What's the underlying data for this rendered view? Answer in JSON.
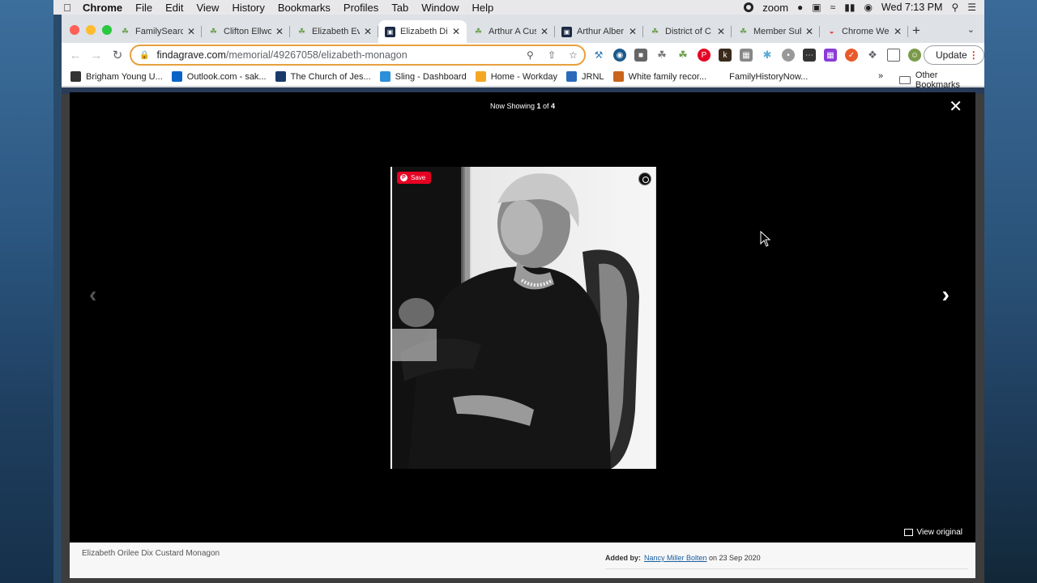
{
  "menubar": {
    "app": "Chrome",
    "items": [
      "File",
      "Edit",
      "View",
      "History",
      "Bookmarks",
      "Profiles",
      "Tab",
      "Window",
      "Help"
    ],
    "zoom": "zoom",
    "clock": "Wed 7:13 PM"
  },
  "tabs": [
    {
      "label": "FamilySearch",
      "icon": "tree-icon"
    },
    {
      "label": "Clifton Ellwo",
      "icon": "tree-icon"
    },
    {
      "label": "Elizabeth Ev",
      "icon": "tree-icon"
    },
    {
      "label": "Elizabeth Di",
      "icon": "findagrave-icon",
      "active": true
    },
    {
      "label": "Arthur A Cus",
      "icon": "tree-icon"
    },
    {
      "label": "Arthur Alber",
      "icon": "findagrave-icon"
    },
    {
      "label": "District of C",
      "icon": "tree-icon"
    },
    {
      "label": "Member Sub",
      "icon": "tree-icon"
    },
    {
      "label": "Chrome Web",
      "icon": "chrome-web-store-icon"
    }
  ],
  "address": {
    "host": "findagrave.com",
    "path": "/memorial/49267058/elizabeth-monagon"
  },
  "update_label": "Update",
  "bookmarks": [
    {
      "label": "Brigham Young U...",
      "color": "#333333"
    },
    {
      "label": "Outlook.com - sak...",
      "color": "#0a64c8"
    },
    {
      "label": "The Church of Jes...",
      "color": "#1a3a6a"
    },
    {
      "label": "Sling - Dashboard",
      "color": "#2d8fd8"
    },
    {
      "label": "Home - Workday",
      "color": "#f5a623"
    },
    {
      "label": "JRNL",
      "color": "#2a6aba"
    },
    {
      "label": "White family recor...",
      "color": "#c8651a"
    },
    {
      "label": "FamilyHistoryNow...",
      "color": "#ffffff"
    }
  ],
  "bookmarks_more": "»",
  "other_bookmarks": "Other Bookmarks",
  "viewer": {
    "now_showing_prefix": "Now Showing ",
    "current": "1",
    "of": " of ",
    "total": "4",
    "save_label": "Save",
    "view_original": "View original",
    "caption": "Elizabeth Orilee Dix Custard Monagon",
    "added_by_label": "Added by:",
    "added_by_name": "Nancy Miller Bolten",
    "added_on": " on 23 Sep 2020"
  }
}
